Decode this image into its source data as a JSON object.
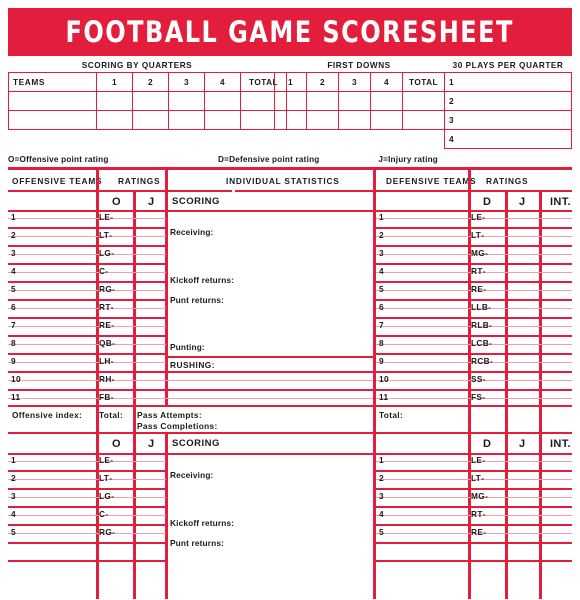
{
  "title": "FOOTBALL GAME SCORESHEET",
  "colors": {
    "red": "#e31e3c",
    "pink": "#f49dac",
    "ink": "#1a1a1a",
    "paper": "#ffffff"
  },
  "top": {
    "scoring_by_quarters": {
      "caption": "SCORING BY QUARTERS",
      "teams_label": "TEAMS",
      "columns": [
        "1",
        "2",
        "3",
        "4",
        "TOTAL"
      ],
      "rows": 2
    },
    "first_downs": {
      "caption": "FIRST DOWNS",
      "columns": [
        "1",
        "2",
        "3",
        "4",
        "TOTAL"
      ],
      "rows": 2
    },
    "plays_per_quarter": {
      "caption": "30 PLAYS PER QUARTER",
      "rows": [
        "1",
        "2",
        "3",
        "4"
      ]
    },
    "legend": {
      "offensive": "O=Offensive point rating",
      "defensive": "D=Defensive point rating",
      "injury": "J=Injury rating"
    }
  },
  "main": {
    "headers": {
      "offensive_teams": "OFFENSIVE TEAMS",
      "ratings_left": "RATINGS",
      "individual_statistics": "INDIVIDUAL STATISTICS",
      "defensive_teams": "DEFENSIVE TEAMS",
      "ratings_right": "RATINGS"
    },
    "subheaders": {
      "o": "O",
      "j_left": "J",
      "scoring": "SCORING",
      "d": "D",
      "j_right": "J",
      "int": "INT."
    },
    "offense_positions": [
      {
        "num": "1",
        "pos": "LE"
      },
      {
        "num": "2",
        "pos": "LT"
      },
      {
        "num": "3",
        "pos": "LG"
      },
      {
        "num": "4",
        "pos": "C"
      },
      {
        "num": "5",
        "pos": "RG"
      },
      {
        "num": "6",
        "pos": "RT"
      },
      {
        "num": "7",
        "pos": "RE"
      },
      {
        "num": "8",
        "pos": "QB"
      },
      {
        "num": "9",
        "pos": "LH"
      },
      {
        "num": "10",
        "pos": "RH"
      },
      {
        "num": "11",
        "pos": "FB"
      }
    ],
    "defense_positions": [
      {
        "num": "1",
        "pos": "LE"
      },
      {
        "num": "2",
        "pos": "LT"
      },
      {
        "num": "3",
        "pos": "MG"
      },
      {
        "num": "4",
        "pos": "RT"
      },
      {
        "num": "5",
        "pos": "RE"
      },
      {
        "num": "6",
        "pos": "LLB"
      },
      {
        "num": "7",
        "pos": "RLB"
      },
      {
        "num": "8",
        "pos": "LCB"
      },
      {
        "num": "9",
        "pos": "RCB"
      },
      {
        "num": "10",
        "pos": "SS"
      },
      {
        "num": "11",
        "pos": "FS"
      }
    ],
    "stat_labels": {
      "receiving": "Receiving:",
      "kickoff_returns": "Kickoff returns:",
      "punt_returns": "Punt returns:",
      "punting": "Punting:",
      "rushing": "RUSHING:"
    },
    "totals_row": {
      "offensive_index": "Offensive index:",
      "total_left": "Total:",
      "pass_attempts": "Pass Attempts:",
      "pass_completions": "Pass Completions:",
      "total_right": "Total:"
    }
  },
  "section2": {
    "subheaders": {
      "o": "O",
      "j_left": "J",
      "scoring": "SCORING",
      "d": "D",
      "j_right": "J",
      "int": "INT."
    },
    "offense_positions": [
      {
        "num": "1",
        "pos": "LE"
      },
      {
        "num": "2",
        "pos": "LT"
      },
      {
        "num": "3",
        "pos": "LG"
      },
      {
        "num": "4",
        "pos": "C"
      },
      {
        "num": "5",
        "pos": "RG"
      }
    ],
    "defense_positions": [
      {
        "num": "1",
        "pos": "LE"
      },
      {
        "num": "2",
        "pos": "LT"
      },
      {
        "num": "3",
        "pos": "MG"
      },
      {
        "num": "4",
        "pos": "RT"
      },
      {
        "num": "5",
        "pos": "RE"
      }
    ],
    "stat_labels": {
      "receiving": "Receiving:",
      "kickoff_returns": "Kickoff returns:",
      "punt_returns": "Punt returns:"
    }
  }
}
